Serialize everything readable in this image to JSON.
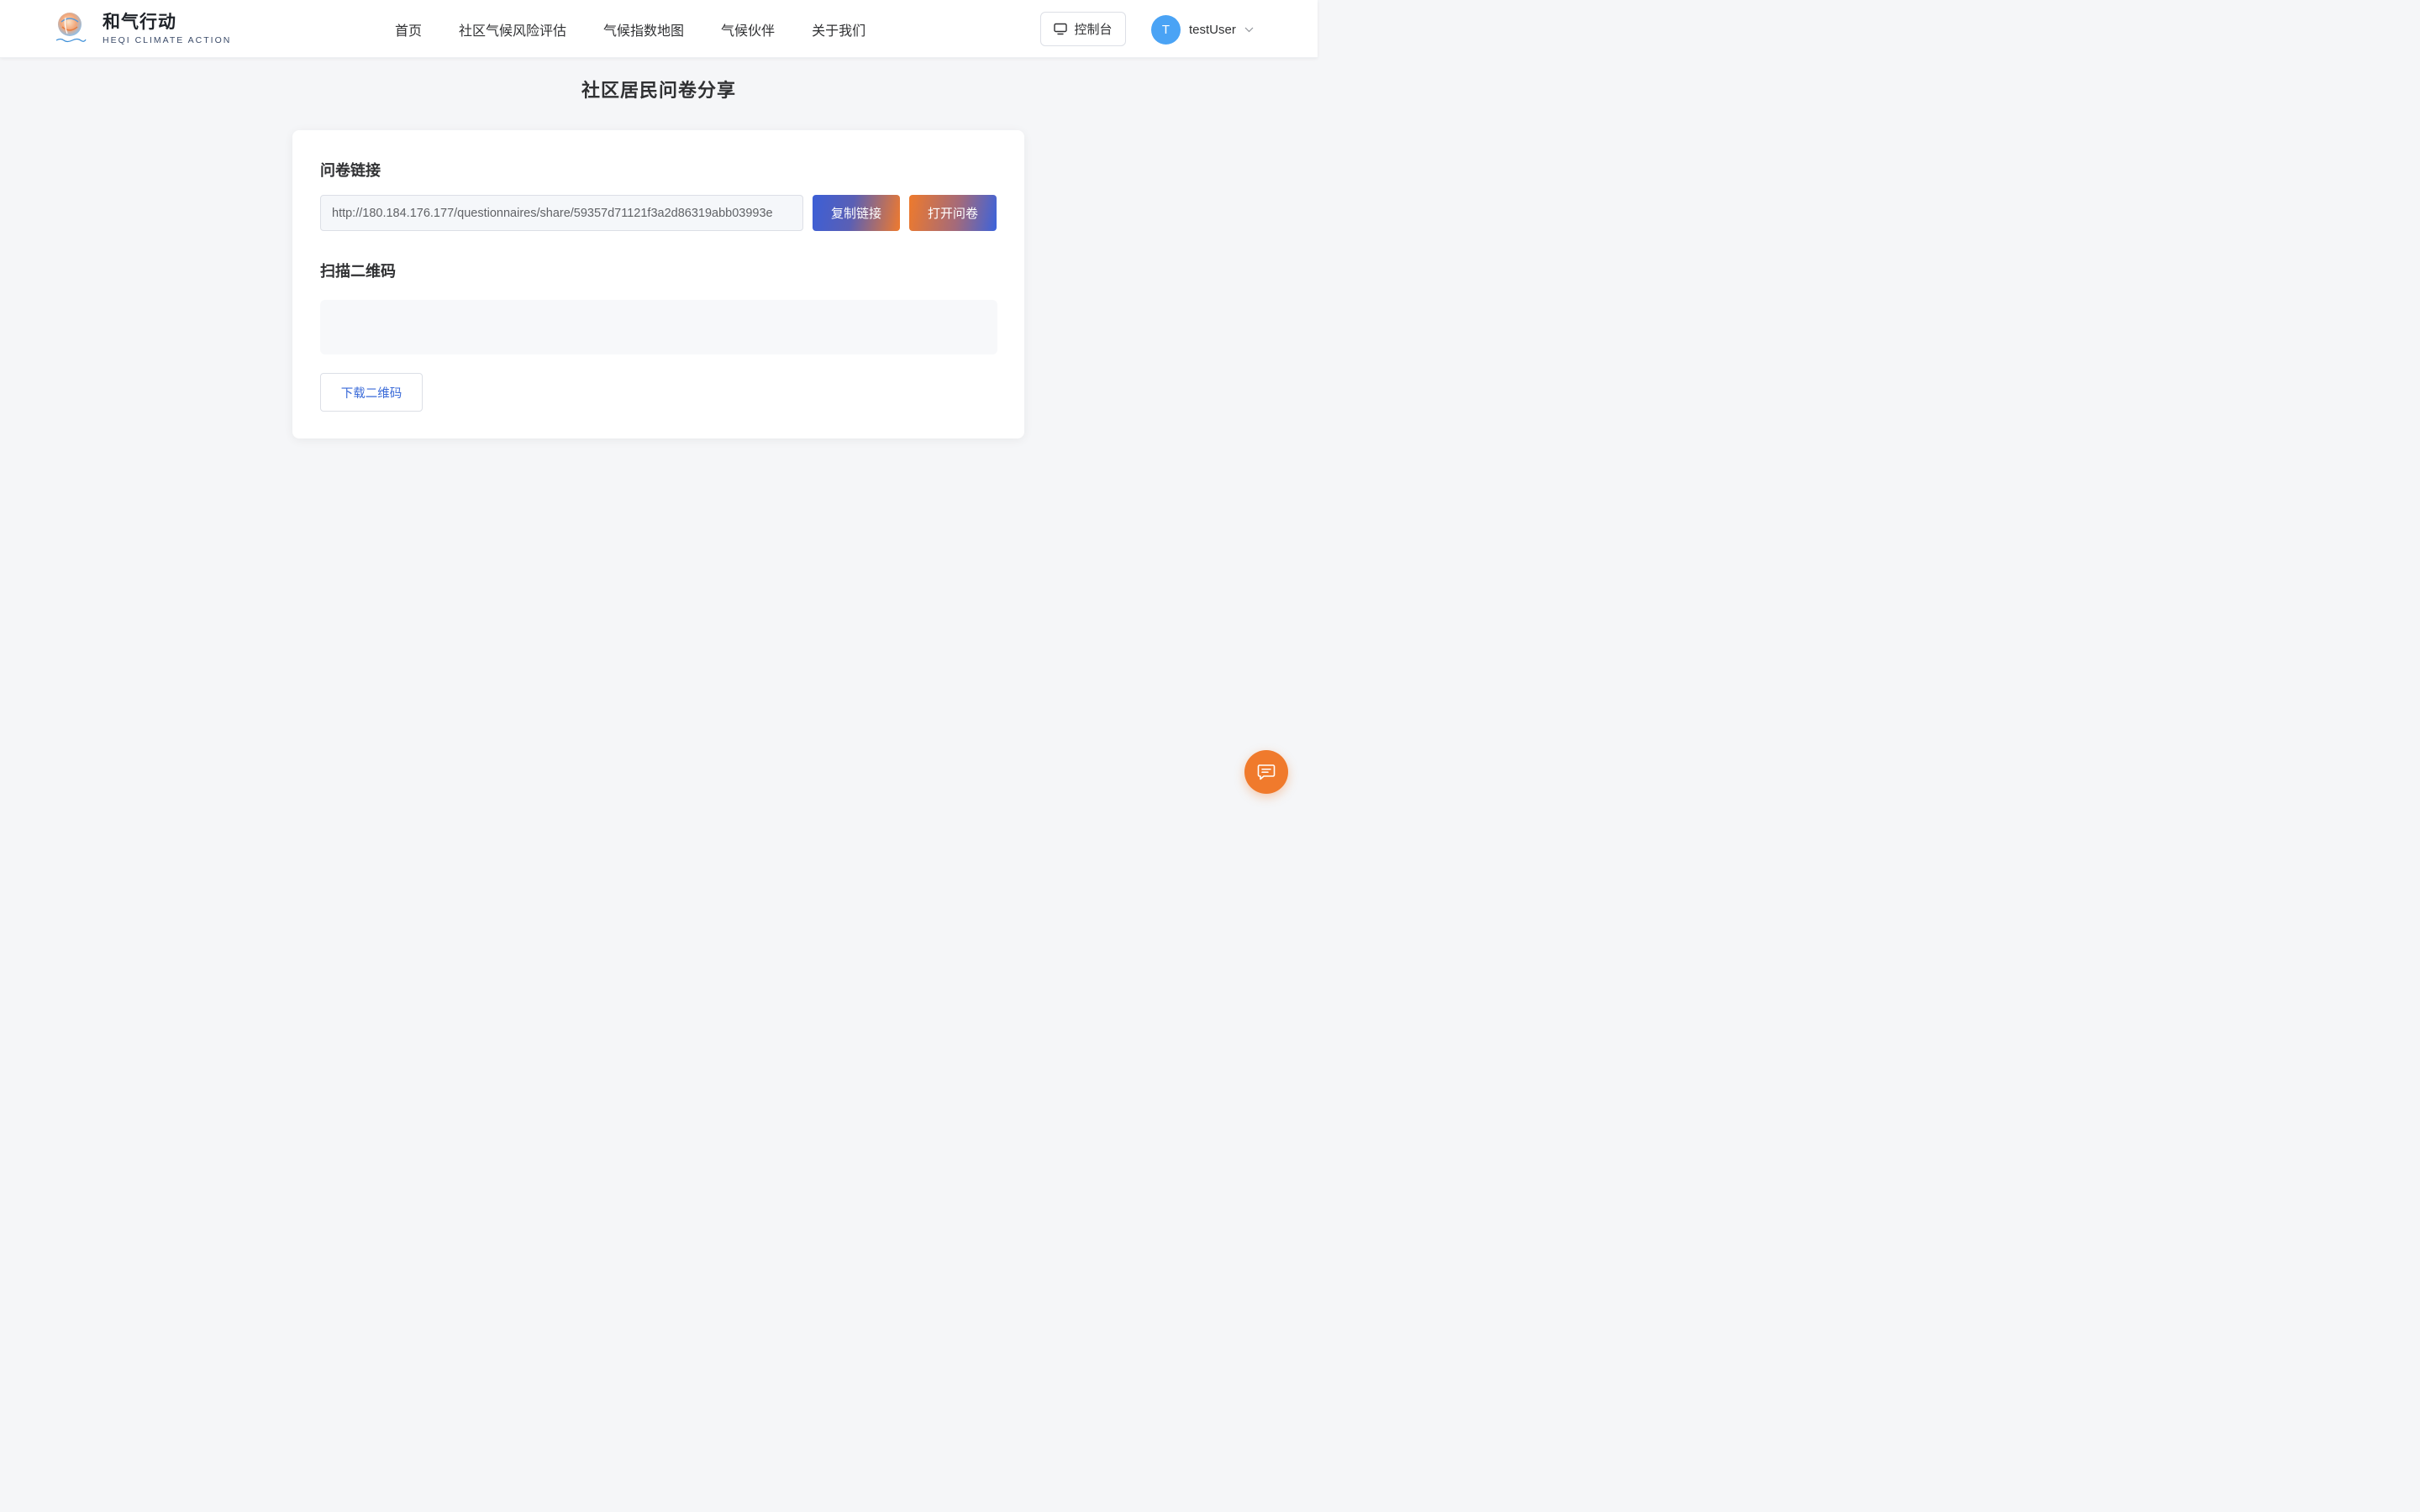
{
  "brand": {
    "name": "和气行动",
    "subtitle": "HEQI CLIMATE ACTION",
    "logo_icon": "globe-logo-icon"
  },
  "nav": {
    "items": [
      {
        "label": "首页"
      },
      {
        "label": "社区气候风险评估"
      },
      {
        "label": "气候指数地图"
      },
      {
        "label": "气候伙伴"
      },
      {
        "label": "关于我们"
      }
    ]
  },
  "header": {
    "console_label": "控制台",
    "console_icon": "monitor-icon",
    "user_initial": "T",
    "username": "testUser",
    "user_menu_icon": "chevron-down-icon"
  },
  "page": {
    "title": "社区居民问卷分享"
  },
  "card": {
    "link_section_title": "问卷链接",
    "link_value": "http://180.184.176.177/questionnaires/share/59357d71121f3a2d86319abb03993e",
    "copy_label": "复制链接",
    "open_label": "打开问卷",
    "qr_section_title": "扫描二维码",
    "download_label": "下载二维码"
  },
  "chat": {
    "icon": "chat-icon"
  },
  "colors": {
    "accent_blue": "#3c5fd6",
    "accent_orange": "#ef7a2e",
    "avatar": "#4aa3f5",
    "background": "#f5f6f8"
  }
}
